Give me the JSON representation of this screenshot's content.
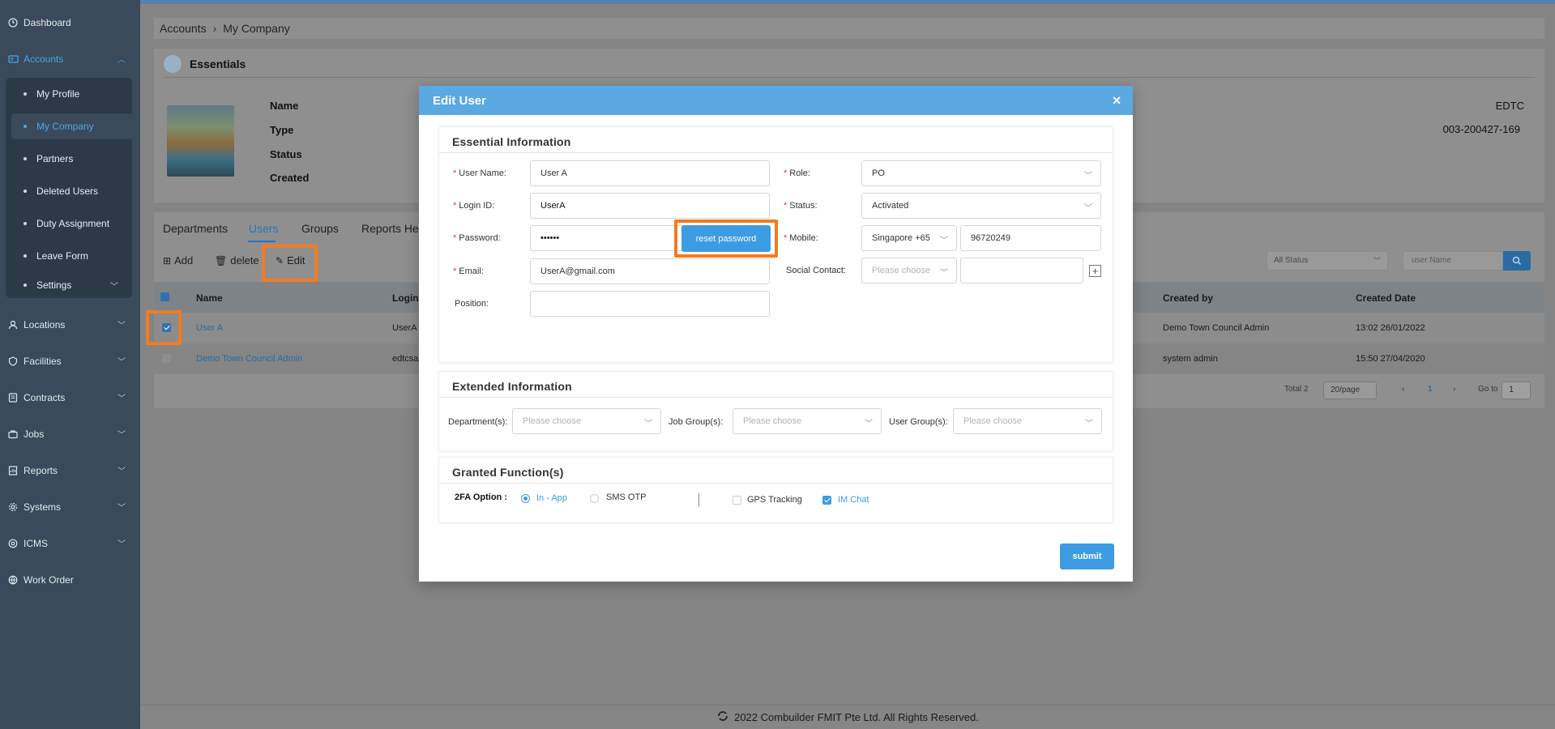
{
  "sidebar": {
    "items": [
      {
        "label": "Dashboard",
        "icon": "clock-icon"
      },
      {
        "label": "Accounts",
        "icon": "id-card-icon"
      },
      {
        "label": "Locations",
        "icon": "user-pin-icon"
      },
      {
        "label": "Facilities",
        "icon": "shield-icon"
      },
      {
        "label": "Contracts",
        "icon": "document-icon"
      },
      {
        "label": "Jobs",
        "icon": "briefcase-icon"
      },
      {
        "label": "Reports",
        "icon": "report-icon"
      },
      {
        "label": "Systems",
        "icon": "gear-icon"
      },
      {
        "label": "ICMS",
        "icon": "at-icon"
      },
      {
        "label": "Work Order",
        "icon": "globe-icon"
      }
    ],
    "sub_items": [
      {
        "label": "My Profile"
      },
      {
        "label": "My Company"
      },
      {
        "label": "Partners"
      },
      {
        "label": "Deleted Users"
      },
      {
        "label": "Duty Assignment"
      },
      {
        "label": "Leave Form"
      },
      {
        "label": "Settings"
      }
    ],
    "accent_color": "#4aa6e6"
  },
  "breadcrumb": {
    "root": "Accounts",
    "current": "My Company"
  },
  "essentials": {
    "title": "Essentials",
    "labels": [
      "Name",
      "Type",
      "Status",
      "Created"
    ],
    "values": [
      "EDTC",
      "003-200427-169"
    ]
  },
  "users_panel": {
    "tabs": [
      "Departments",
      "Users",
      "Groups",
      "Reports Hea"
    ],
    "toolbar": {
      "add": "Add",
      "delete": "delete",
      "edit": "Edit"
    },
    "status_filter": "All Status",
    "search_placeholder": "user Name",
    "columns": [
      "Name",
      "Login",
      "Created by",
      "Created Date"
    ],
    "rows": [
      {
        "name": "User A",
        "login": "UserA",
        "created_by": "Demo Town Council Admin",
        "created_date": "13:02 26/01/2022",
        "checked": true
      },
      {
        "name": "Demo Town Council Admin",
        "login": "edtcsa",
        "created_by": "system admin",
        "created_date": "15:50 27/04/2020",
        "checked": false
      }
    ],
    "pagination": {
      "total": "Total 2",
      "page_size": "20/page",
      "current_page": "1",
      "goto_label": "Go to",
      "goto_value": "1"
    }
  },
  "modal": {
    "title": "Edit User",
    "essential_section": "Essential Information",
    "fields": {
      "user_name": {
        "label": "User Name:",
        "value": "User A"
      },
      "login_id": {
        "label": "Login ID:",
        "value": "UserA"
      },
      "password": {
        "label": "Password:",
        "value": "••••••"
      },
      "email": {
        "label": "Email:",
        "value": "UserA@gmail.com"
      },
      "position": {
        "label": "Position:",
        "value": ""
      },
      "role": {
        "label": "Role:",
        "value": "PO"
      },
      "status": {
        "label": "Status:",
        "value": "Activated"
      },
      "mobile": {
        "label": "Mobile:",
        "country": "Singapore +65",
        "number": "96720249"
      },
      "social": {
        "label": "Social Contact:",
        "placeholder": "Please choose"
      }
    },
    "reset_password": "reset password",
    "extended_section": "Extended Information",
    "extended": {
      "department_label": "Department(s):",
      "job_group_label": "Job Group(s):",
      "user_group_label": "User Group(s):",
      "placeholder": "Please choose"
    },
    "granted_section": "Granted Function(s)",
    "granted": {
      "twofa_label": "2FA Option :",
      "in_app": "In - App",
      "sms_otp": "SMS OTP",
      "gps_tracking": "GPS Tracking",
      "im_chat": "IM Chat",
      "in_app_selected": true,
      "gps_checked": false,
      "im_chat_checked": true
    },
    "submit": "submit",
    "header_color": "#5aa9e2",
    "button_color": "#3d9be4"
  },
  "footer": {
    "text": "2022 Combuilder FMIT Pte Ltd. All Rights Reserved."
  },
  "highlight_color": "#f47b20"
}
